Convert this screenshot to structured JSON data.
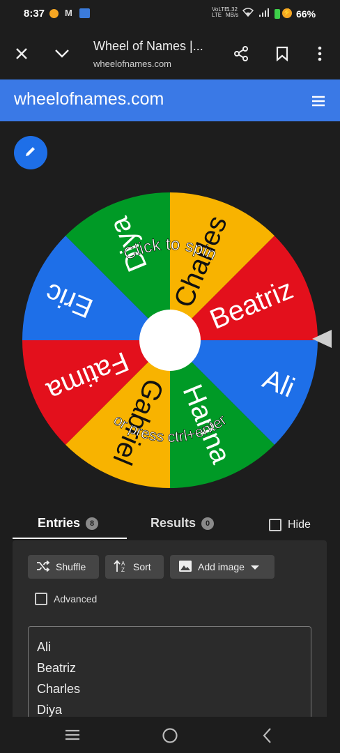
{
  "status_bar": {
    "time": "8:37",
    "gmail_icon": "M",
    "network_line1": "VoLTE",
    "network_line2": "LTE",
    "speed_value": "1.32",
    "speed_unit": "MB/s",
    "battery": "66%"
  },
  "browser": {
    "title": "Wheel of Names |...",
    "url": "wheelofnames.com"
  },
  "site": {
    "title": "wheelofnames.com",
    "accent": "#3a79e6"
  },
  "wheel": {
    "entries": [
      "Ali",
      "Beatriz",
      "Charles",
      "Diya",
      "Eric",
      "Fatima",
      "Gabriel",
      "Hanna"
    ],
    "colors": [
      "#1e6fe8",
      "#e3101c",
      "#f8b300",
      "#009a26",
      "#1e6fe8",
      "#e3101c",
      "#f8b300",
      "#009a26"
    ],
    "top_text": "Click to spin",
    "bottom_text": "or press ctrl+enter"
  },
  "tabs": {
    "entries_label": "Entries",
    "entries_count": "8",
    "results_label": "Results",
    "results_count": "0",
    "hide_label": "Hide"
  },
  "actions": {
    "shuffle": "Shuffle",
    "sort": "Sort",
    "add_image": "Add image",
    "advanced": "Advanced"
  },
  "entries_text": [
    "Ali",
    "Beatriz",
    "Charles",
    "Diya"
  ]
}
